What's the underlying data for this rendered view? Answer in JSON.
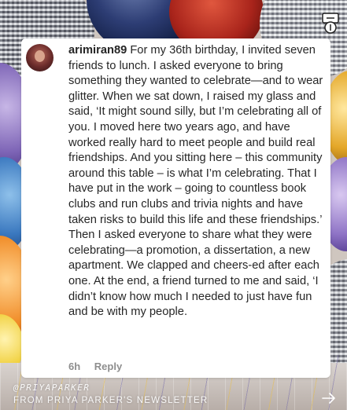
{
  "post": {
    "username": "arimiran89",
    "text": "For my 36th birthday, I invited seven friends to lunch. I asked everyone to bring something they wanted to celebrate—and to wear glitter. When we sat down, I raised my glass and said, ‘It might sound silly, but I’m celebrating all of you. I moved here two years ago, and have worked really hard to meet people and build real friendships. And you sitting here – this community around this table – is what I’m celebrating. That I have put in the work – going to countless book clubs and run clubs and trivia nights and have taken risks to build this life and these friendships.’ Then I asked everyone to share what they were celebrating—a promotion, a dissertation, a new apartment. We clapped and cheers-ed after each one. At the end, a friend turned to me and said, ‘I didn’t know how much I needed to just have fun and be with my people.",
    "time_ago": "6h",
    "reply_label": "Reply"
  },
  "footer": {
    "handle": "@PRIYAPARKER",
    "source": "FROM PRIYA PARKER'S NEWSLETTER"
  },
  "icons": {
    "logo": "brand-logo-icon",
    "next": "arrow-right-icon"
  },
  "colors": {
    "card_bg": "#ffffff",
    "text": "#262626",
    "meta": "#8e8e8e"
  }
}
